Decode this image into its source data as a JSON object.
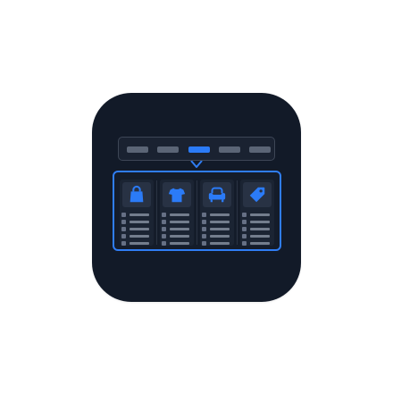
{
  "icon": {
    "theme": "dark",
    "background_color": "#121a28",
    "accent_color": "#2b7bf7",
    "neutral_color": "#5b6576"
  },
  "navigation": {
    "active_index": 2,
    "items": [
      {
        "state": "inactive"
      },
      {
        "state": "inactive"
      },
      {
        "state": "active"
      },
      {
        "state": "inactive"
      },
      {
        "state": "inactive"
      }
    ]
  },
  "megamenu": {
    "categories": [
      {
        "icon": "shopping-bag-icon"
      },
      {
        "icon": "t-shirt-icon"
      },
      {
        "icon": "armchair-icon"
      },
      {
        "icon": "price-tag-icon"
      }
    ],
    "items_per_category": 5
  }
}
